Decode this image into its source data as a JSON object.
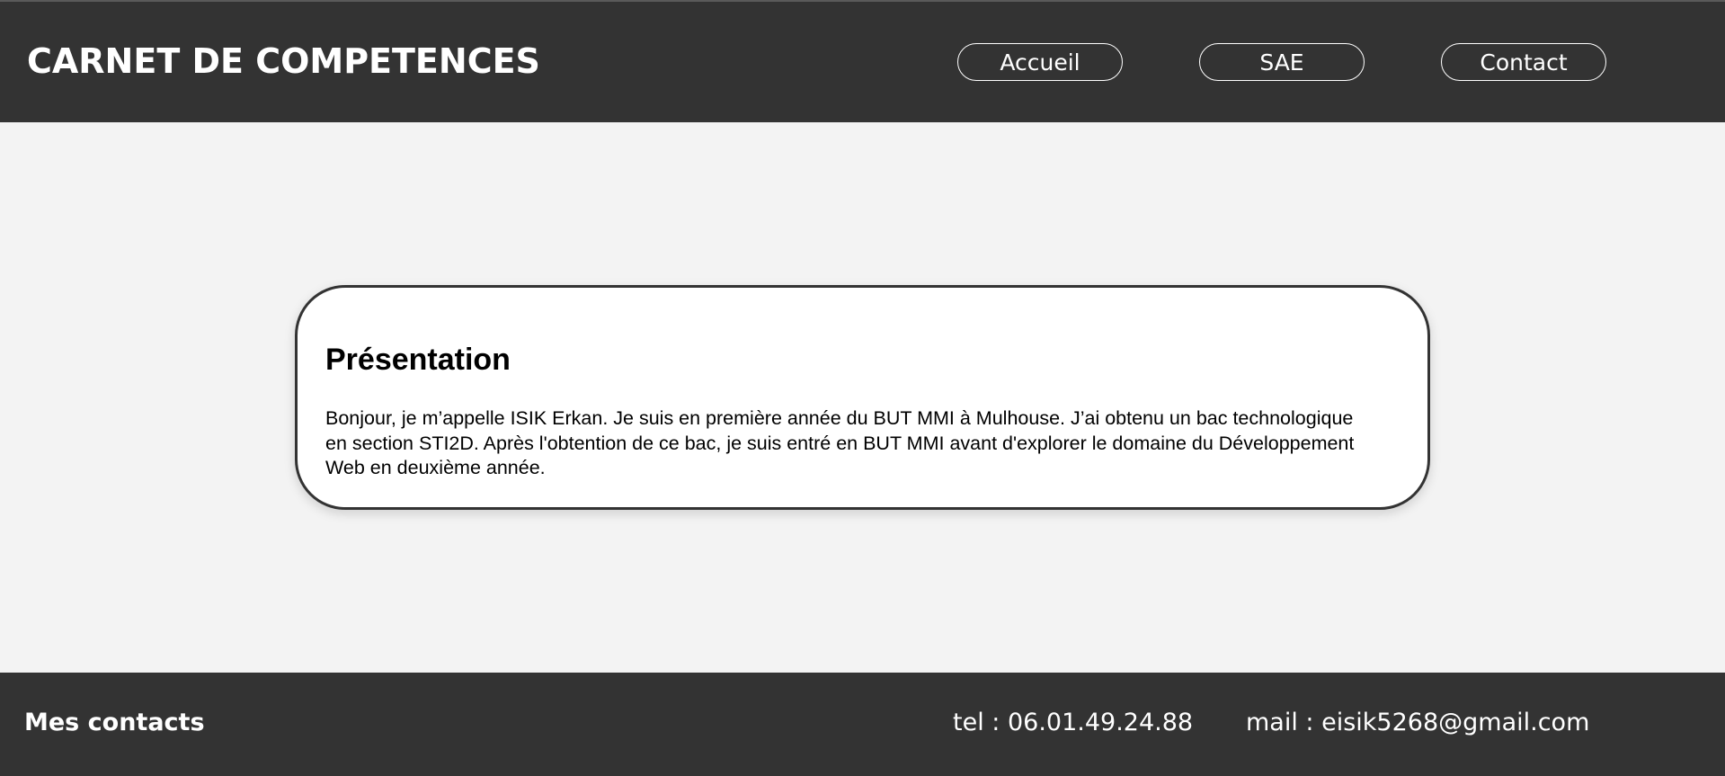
{
  "header": {
    "title": "CARNET DE COMPETENCES",
    "nav": [
      {
        "label": "Accueil"
      },
      {
        "label": "SAE"
      },
      {
        "label": "Contact"
      }
    ]
  },
  "main": {
    "card": {
      "heading": "Présentation",
      "text": "Bonjour, je m’appelle ISIK Erkan. Je suis en première année du BUT MMI à Mulhouse. J’ai obtenu un bac technologique en section STI2D. Après l'obtention de ce bac, je suis entré en BUT MMI avant d'explorer le domaine du Développement Web en deuxième année."
    }
  },
  "footer": {
    "title": "Mes contacts",
    "tel": "tel : 06.01.49.24.88",
    "mail": "mail : eisik5268@gmail.com"
  },
  "colors": {
    "header_bg": "#333333",
    "page_bg": "#f3f3f3",
    "card_bg": "#ffffff"
  }
}
